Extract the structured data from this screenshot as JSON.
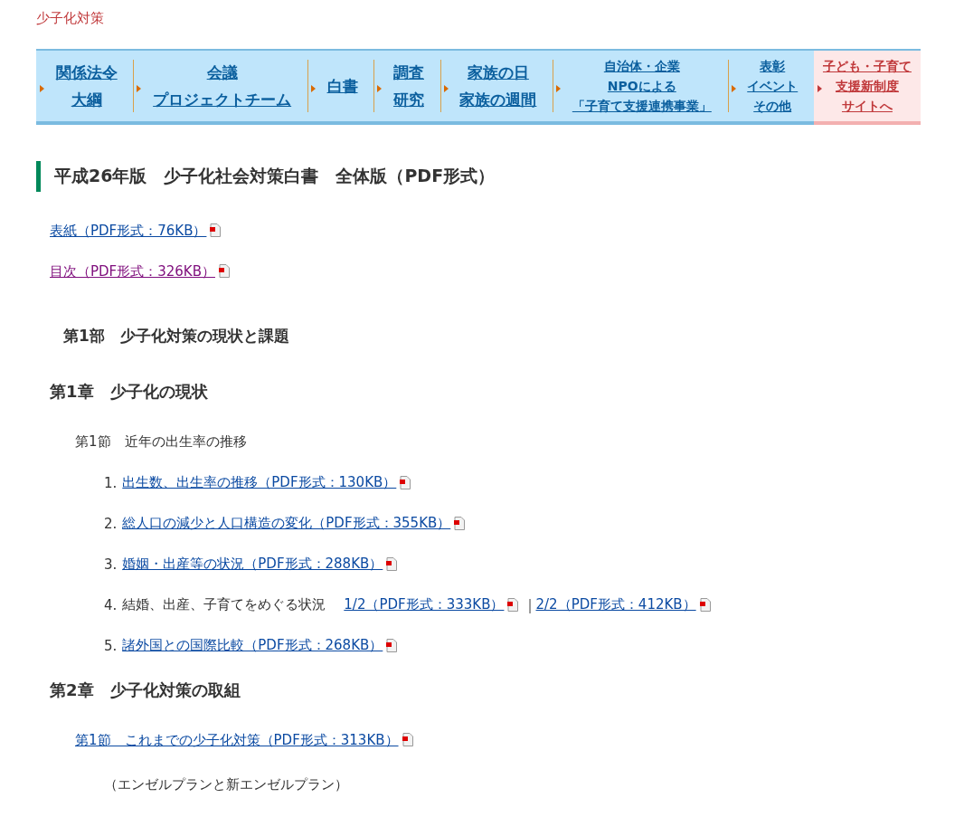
{
  "site_title": "少子化対策",
  "nav": [
    {
      "kind": "internal",
      "lines": [
        "関係法令",
        "大綱"
      ]
    },
    {
      "kind": "internal",
      "lines": [
        "会議",
        "プロジェクトチーム"
      ]
    },
    {
      "kind": "internal",
      "lines": [
        "白書"
      ]
    },
    {
      "kind": "internal",
      "lines": [
        "調査",
        "研究"
      ]
    },
    {
      "kind": "internal",
      "lines": [
        "家族の日",
        "家族の週間"
      ]
    },
    {
      "kind": "internal",
      "lines": [
        "自治体・企業",
        "NPOによる",
        "「子育て支援連携事業」"
      ]
    },
    {
      "kind": "internal",
      "lines": [
        "表彰",
        "イベント",
        "その他"
      ]
    },
    {
      "kind": "external",
      "lines": [
        "子ども・子育て",
        "支援新制度",
        "サイトへ"
      ]
    }
  ],
  "heading": "平成26年版　少子化社会対策白書　全体版（PDF形式）",
  "front_links": [
    {
      "text": "表紙（PDF形式：76KB）",
      "visited": false
    },
    {
      "text": "目次（PDF形式：326KB）",
      "visited": true
    }
  ],
  "blocks": [
    {
      "kind": "part",
      "text": "第1部　少子化対策の現状と課題"
    },
    {
      "kind": "chapter",
      "text": "第1章　少子化の現状"
    },
    {
      "kind": "section",
      "text": "第1節　近年の出生率の推移"
    },
    {
      "kind": "item",
      "number": "1.",
      "links": [
        {
          "text": "出生数、出生率の推移（PDF形式：130KB）",
          "visited": false
        }
      ]
    },
    {
      "kind": "item",
      "number": "2.",
      "links": [
        {
          "text": "総人口の減少と人口構造の変化（PDF形式：355KB）",
          "visited": false
        }
      ]
    },
    {
      "kind": "item",
      "number": "3.",
      "links": [
        {
          "text": "婚姻・出産等の状況（PDF形式：288KB）",
          "visited": false
        }
      ]
    },
    {
      "kind": "item",
      "number": "4.",
      "text": "結婚、出産、子育てをめぐる状況",
      "separator": "|",
      "links": [
        {
          "text": "1/2（PDF形式：333KB）",
          "visited": false
        },
        {
          "text": "2/2（PDF形式：412KB）",
          "visited": false
        }
      ]
    },
    {
      "kind": "item",
      "number": "5.",
      "links": [
        {
          "text": "諸外国との国際比較（PDF形式：268KB）",
          "visited": false
        }
      ]
    },
    {
      "kind": "chapter",
      "text": "第2章　少子化対策の取組"
    },
    {
      "kind": "section_link",
      "links": [
        {
          "text": "第1節　これまでの少子化対策（PDF形式：313KB）",
          "visited": false
        }
      ]
    },
    {
      "kind": "note",
      "text": "（エンゼルプランと新エンゼルプラン）"
    }
  ]
}
